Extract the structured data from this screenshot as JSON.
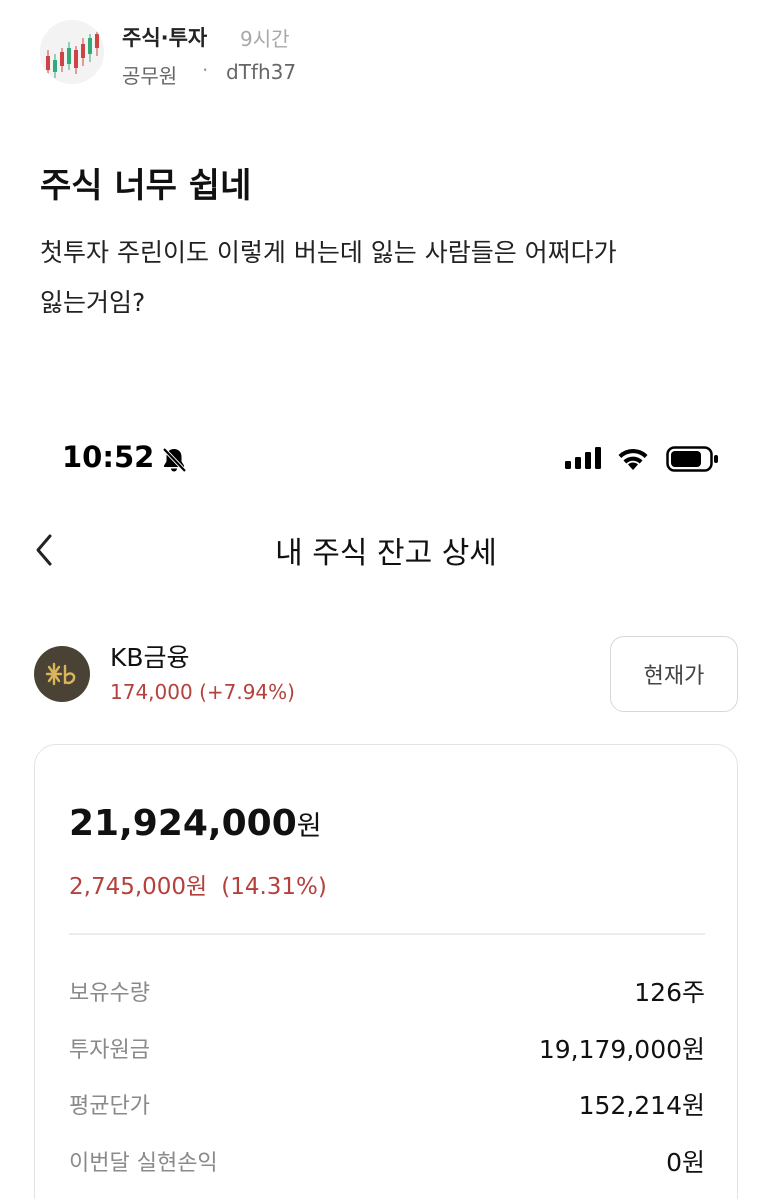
{
  "post": {
    "category": "주식·투자",
    "time_ago": "9시간",
    "author_job": "공무원",
    "separator": "·",
    "author_id": "dTfh37",
    "title": "주식 너무 쉽네",
    "body_line1": "첫투자 주린이도 이렇게 버는데 잃는 사람들은 어쩌다가",
    "body_line2": "잃는거임?"
  },
  "phone": {
    "status_bar": {
      "time": "10:52",
      "icons": [
        "bell-slash-icon",
        "cellular-signal-icon",
        "wifi-icon",
        "battery-icon"
      ]
    },
    "nav": {
      "back_icon": "chevron-left-icon",
      "title": "내 주식 잔고 상세"
    },
    "stock": {
      "name": "KB금융",
      "price_change": "174,000 (+7.94%)",
      "current_price_button": "현재가"
    },
    "holding": {
      "total_value": "21,924,000",
      "total_unit": "원",
      "profit_amount": "2,745,000원",
      "profit_rate": "(14.31%)",
      "rows": [
        {
          "label": "보유수량",
          "value": "126주"
        },
        {
          "label": "투자원금",
          "value": "19,179,000원"
        },
        {
          "label": "평균단가",
          "value": "152,214원"
        },
        {
          "label": "이번달 실현손익",
          "value": "0원"
        }
      ]
    }
  },
  "colors": {
    "loss_red": "#b5413d",
    "muted_gray": "#8a8a8a",
    "logo_bg": "#4a4335",
    "logo_gold": "#d9b45a"
  }
}
